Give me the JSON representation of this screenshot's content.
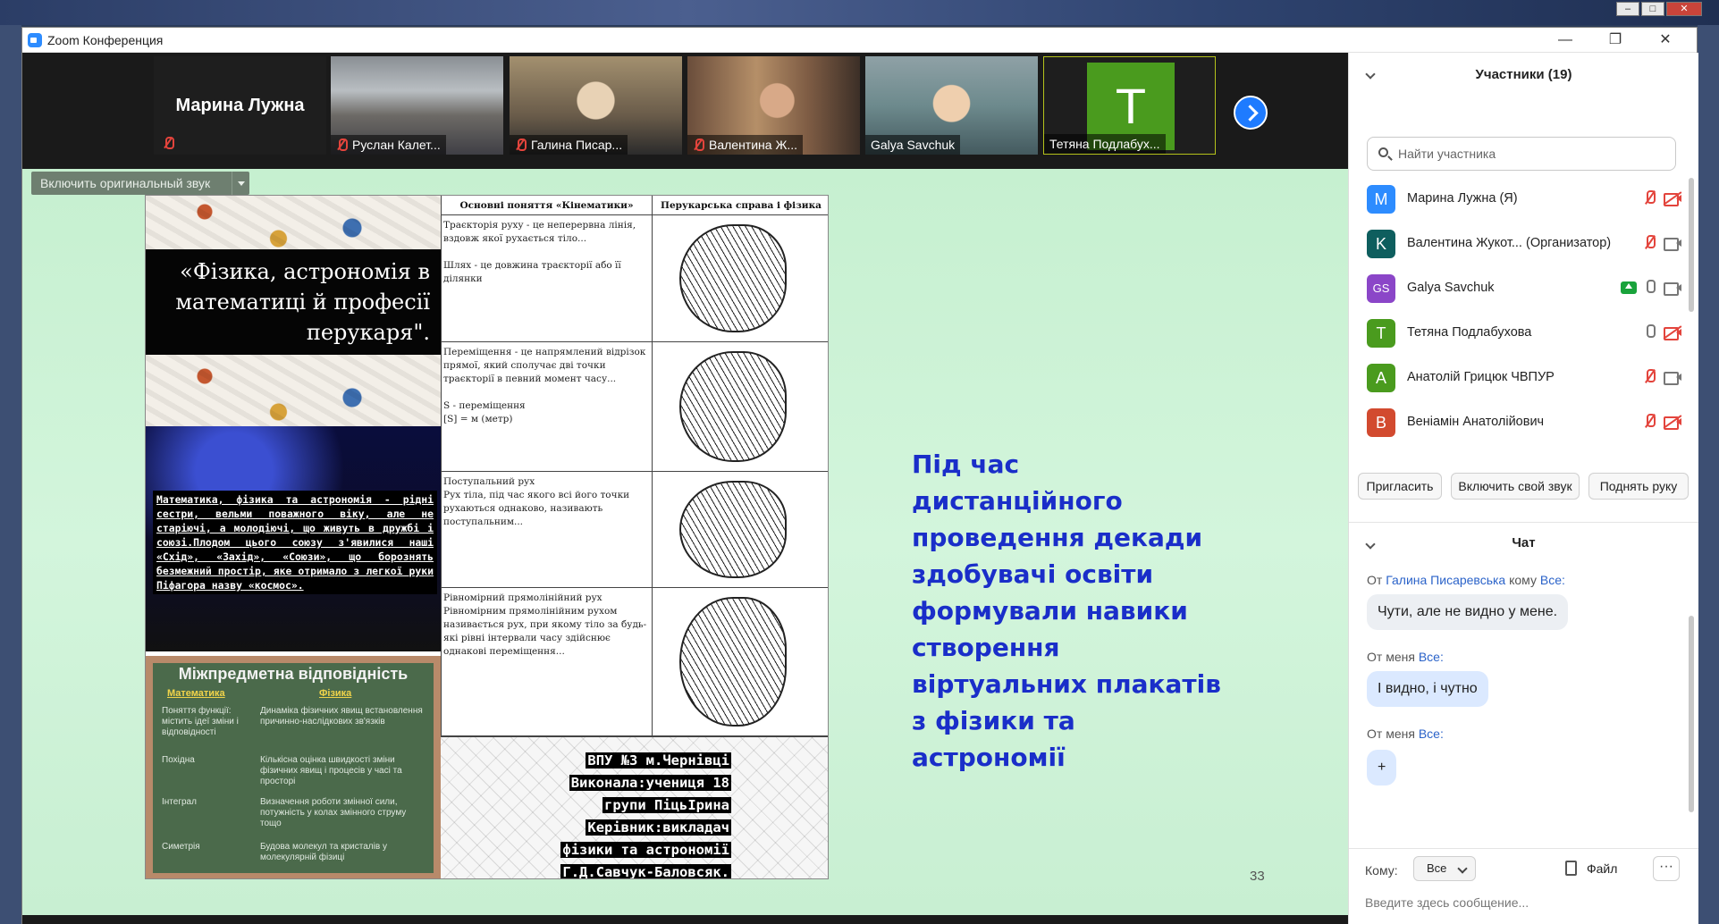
{
  "window": {
    "title": "Zoom Конференция"
  },
  "video_strip": {
    "active_speaker": "Марина Лужна",
    "tiles": [
      {
        "name": "Руслан Калет...",
        "muted": true
      },
      {
        "name": "Галина Писар...",
        "muted": true
      },
      {
        "name": "Валентина Ж...",
        "muted": true
      },
      {
        "name": "Galya Savchuk",
        "muted": false
      },
      {
        "name": "Тетяна Подлабух...",
        "muted": false,
        "avatar_letter": "T",
        "avatar_color": "#4a9b1e"
      }
    ]
  },
  "share": {
    "original_sound_label": "Включить оригинальный звук",
    "slide_number": "33",
    "slide_text": "Під час дистанційного проведення декади здобувачі освіти формували навики створення віртуальних плакатів з фізики та астрономії",
    "poster": {
      "title": "«Фізика, астрономія в математиці й професії перукаря\".",
      "space_text": "Математика, фізика та астрономія - рідні сестри, вельми поважного віку, але не старіючі, а молодіючі, що живуть в дружбі і союзі.Плодом цього союзу з'явилися наші «Схід», «Захід», «Союзи», що борознять безмежний простір, яке отримало з легкої руки Піфагора назву «космос».",
      "board": {
        "title": "Міжпредметна відповідність",
        "col_math": "Математика",
        "col_phys": "Фізика",
        "rows": [
          {
            "left": "Поняття функції: містить ідеї зміни і відповідності",
            "right": "Динаміка фізичних явищ встановлення причинно-наслідкових зв'язків"
          },
          {
            "left": "Похідна",
            "right": "Кількісна оцінка швидкості зміни фізичних явищ і процесів у часі та просторі"
          },
          {
            "left": "Інтеграл",
            "right": "Визначення роботи змінної сили, потужність у колах змінного струму тощо"
          },
          {
            "left": "Симетрія",
            "right": "Будова молекул та кристалів у молекулярній фізиці"
          }
        ]
      },
      "col_mid_header": "Основні поняття «Кінематики»",
      "col_right_header": "Перукарська справа і фізика",
      "mid_cells": [
        {
          "text": "Траєкторія руху - це неперервна лінія, вздовж якої рухається тіло...\n\nШлях - це довжина траєкторії або її ділянки"
        },
        {
          "text": "Переміщення - це напрямлений відрізок прямої, який сполучає дві точки траєкторії в певний момент часу...\n\nS - переміщення\n[S] = м (метр)"
        },
        {
          "text": "Поступальний рух\nРух тіла, під час якого всі його точки рухаються однаково, називають поступальним..."
        },
        {
          "text": "Рівномірний прямолінійний рух\nРівномірним прямолінійним рухом називається рух, при якому тіло за будь-які рівні інтервали часу здійснює однакові переміщення..."
        }
      ],
      "credits": [
        "ВПУ №3 м.Чернівці",
        "Виконала:учениця 18",
        "групи ПіцьІрина",
        "Керівник:викладач",
        "фізики та астрономії",
        "Г.Д.Савчук-Баловсяк."
      ]
    }
  },
  "participants": {
    "header": "Участники (19)",
    "search_placeholder": "Найти участника",
    "list": [
      {
        "initial": "M",
        "color": "#2d8cff",
        "name": "Марина Лужна (Я)",
        "mic_off": true,
        "cam_off": true,
        "sharing": false
      },
      {
        "initial": "K",
        "color": "#0e5e5e",
        "name": "Валентина Жукот... (Организатор)",
        "mic_off": true,
        "cam_off": false,
        "sharing": false
      },
      {
        "initial": "GS",
        "color": "#8b46c8",
        "name": "Galya Savchuk",
        "mic_off": false,
        "cam_off": false,
        "sharing": true
      },
      {
        "initial": "T",
        "color": "#4a9b1e",
        "name": "Тетяна Подлабухова",
        "mic_off": false,
        "cam_off": true,
        "sharing": false
      },
      {
        "initial": "A",
        "color": "#4a9b1e",
        "name": "Анатолій Грицюк ЧВПУР",
        "mic_off": true,
        "cam_off": false,
        "sharing": false
      },
      {
        "initial": "B",
        "color": "#d24a2f",
        "name": "Веніамін Анатолійович",
        "mic_off": true,
        "cam_off": true,
        "sharing": false
      }
    ],
    "buttons": {
      "invite": "Пригласить",
      "unmute": "Включить свой звук",
      "raise_hand": "Поднять руку"
    }
  },
  "chat": {
    "header": "Чат",
    "messages": [
      {
        "from_prefix": "От",
        "from": "Галина Писаревська",
        "to_prefix": "кому",
        "to": "Все:",
        "text": "Чути, але не видно у мене."
      },
      {
        "from_prefix": "От",
        "from": "меня",
        "to": "Все:",
        "text": "І видно, і чутно"
      },
      {
        "from_prefix": "От",
        "from": "меня",
        "to": "Все:",
        "text": "+"
      }
    ],
    "to_label": "Кому:",
    "to_value": "Все",
    "file_label": "Файл",
    "more_label": "···",
    "input_placeholder": "Введите здесь сообщение..."
  }
}
